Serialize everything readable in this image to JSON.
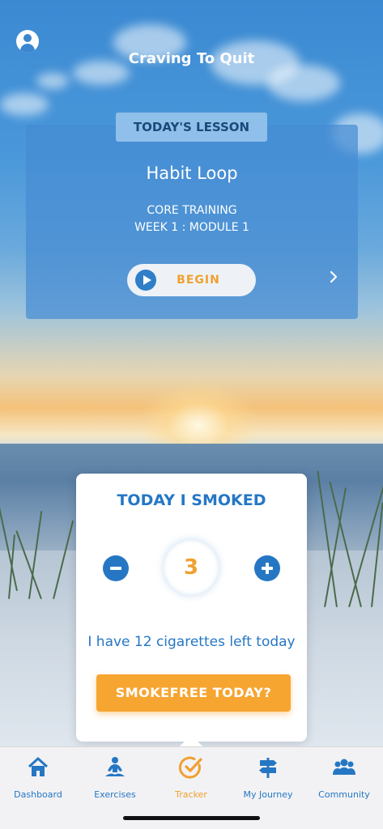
{
  "header": {
    "title": "Craving To Quit"
  },
  "lesson": {
    "tag": "TODAY'S LESSON",
    "name": "Habit Loop",
    "track": "CORE TRAINING",
    "module": "WEEK 1 : MODULE 1",
    "begin_label": "BEGIN"
  },
  "tracker": {
    "title": "TODAY I SMOKED",
    "count": "3",
    "remaining_text": "I have 12 cigarettes left today",
    "smokefree_label": "SMOKEFREE TODAY?"
  },
  "nav": {
    "items": [
      {
        "label": "Dashboard",
        "icon": "home-icon"
      },
      {
        "label": "Exercises",
        "icon": "meditation-icon"
      },
      {
        "label": "Tracker",
        "icon": "check-circle-icon"
      },
      {
        "label": "My Journey",
        "icon": "signpost-icon"
      },
      {
        "label": "Community",
        "icon": "people-icon"
      }
    ],
    "active_color": "#f0a030",
    "inactive_color": "#2577c4"
  },
  "colors": {
    "accent": "#f7a531",
    "primary": "#2577c4"
  }
}
